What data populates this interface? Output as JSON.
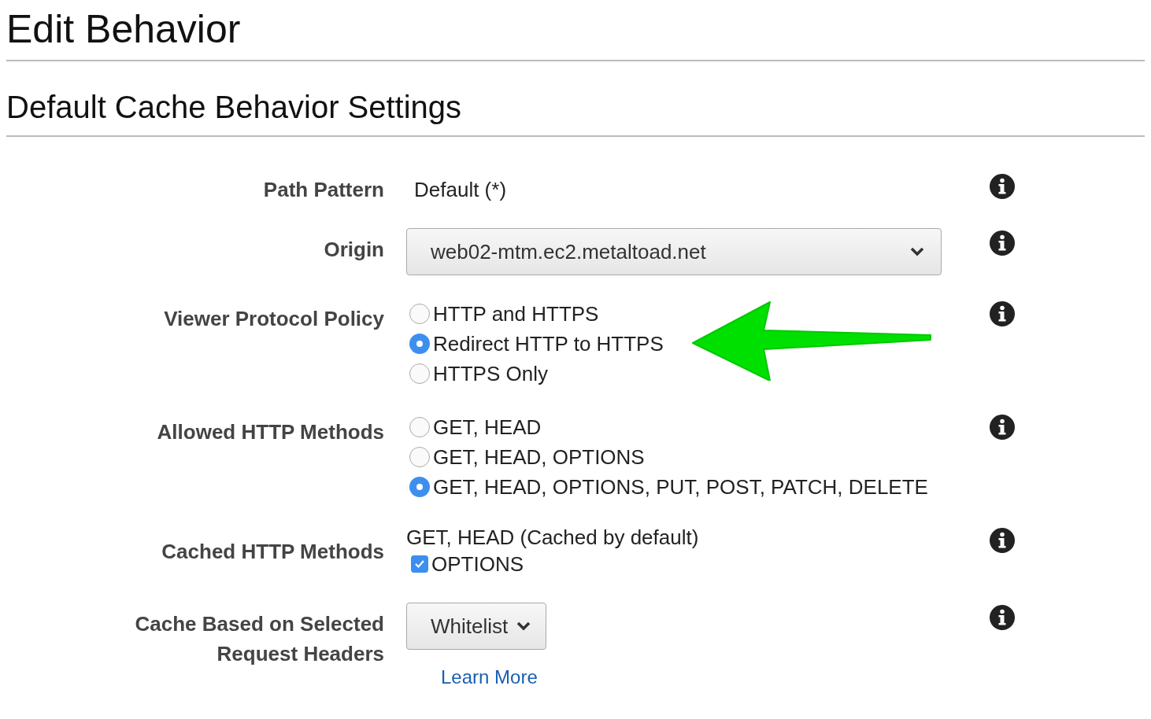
{
  "page_title": "Edit Behavior",
  "section_title": "Default Cache Behavior Settings",
  "fields": [
    {
      "kind": "text",
      "label": "Path Pattern",
      "value": "Default (*)"
    },
    {
      "kind": "select",
      "label": "Origin",
      "value": "web02-mtm.ec2.metaltoad.net"
    },
    {
      "kind": "radio",
      "label": "Viewer Protocol Policy",
      "highlighted": true,
      "options": [
        {
          "label": "HTTP and HTTPS",
          "selected": false
        },
        {
          "label": "Redirect HTTP to HTTPS",
          "selected": true
        },
        {
          "label": "HTTPS Only",
          "selected": false
        }
      ]
    },
    {
      "kind": "radio",
      "label": "Allowed HTTP Methods",
      "options": [
        {
          "label": "GET, HEAD",
          "selected": false
        },
        {
          "label": "GET, HEAD, OPTIONS",
          "selected": false
        },
        {
          "label": "GET, HEAD, OPTIONS, PUT, POST, PATCH, DELETE",
          "selected": true
        }
      ]
    },
    {
      "kind": "checks",
      "label": "Cached HTTP Methods",
      "note": "GET, HEAD (Cached by default)",
      "options": [
        {
          "label": "OPTIONS",
          "checked": true
        }
      ]
    },
    {
      "kind": "dropdown",
      "label": "Cache Based on Selected Request Headers",
      "value": "Whitelist",
      "link": "Learn More"
    }
  ]
}
